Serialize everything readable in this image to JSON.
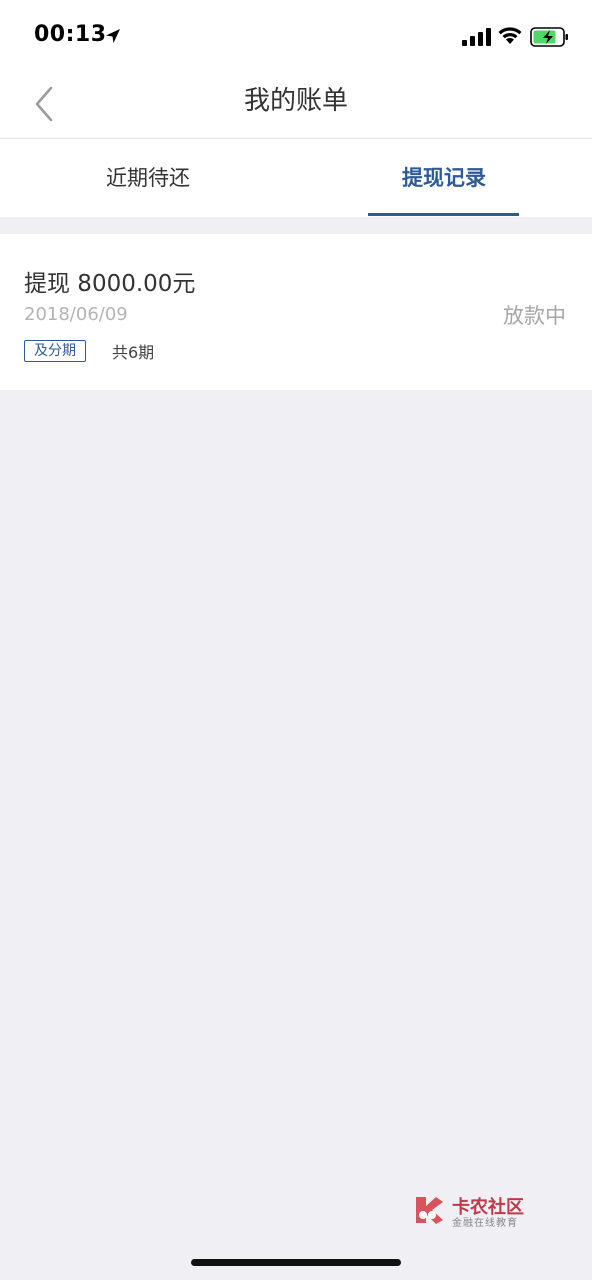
{
  "status_bar": {
    "time": "00:13"
  },
  "nav": {
    "title": "我的账单"
  },
  "tabs": [
    {
      "label": "近期待还",
      "active": false
    },
    {
      "label": "提现记录",
      "active": true
    }
  ],
  "records": [
    {
      "title": "提现 8000.00元",
      "date": "2018/06/09",
      "status": "放款中",
      "badge": "及分期",
      "installments": "共6期"
    }
  ],
  "watermark": {
    "name": "卡农社区",
    "tagline": "金融在线教育"
  },
  "colors": {
    "accent": "#2f5a9a",
    "background": "#efeff4",
    "card": "#ffffff",
    "battery_green": "#4cd964"
  }
}
